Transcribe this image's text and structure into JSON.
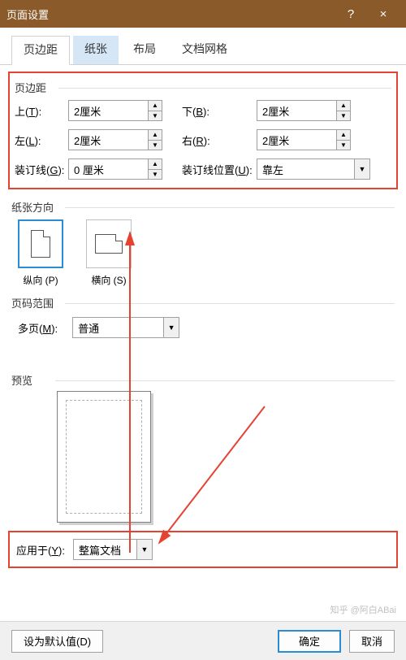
{
  "window": {
    "title": "页面设置",
    "help": "?",
    "close": "×"
  },
  "tabs": {
    "items": [
      "页边距",
      "纸张",
      "布局",
      "文档网格"
    ],
    "active": 0,
    "hover": 1
  },
  "margins": {
    "title": "页边距",
    "top_label": "上(T):",
    "top_value": "2厘米",
    "bottom_label": "下(B):",
    "bottom_value": "2厘米",
    "left_label": "左(L):",
    "left_value": "2厘米",
    "right_label": "右(R):",
    "right_value": "2厘米",
    "gutter_label": "装订线(G):",
    "gutter_value": "0 厘米",
    "gutter_pos_label": "装订线位置(U):",
    "gutter_pos_value": "靠左"
  },
  "orientation": {
    "title": "纸张方向",
    "portrait": "纵向 (P)",
    "landscape": "横向 (S)"
  },
  "pagerange": {
    "title": "页码范围",
    "multi_label": "多页(M):",
    "multi_value": "普通"
  },
  "preview": {
    "title": "预览"
  },
  "apply": {
    "label": "应用于(Y):",
    "value": "整篇文档"
  },
  "footer": {
    "defaults": "设为默认值(D)",
    "ok": "确定",
    "cancel": "取消"
  },
  "watermark": "知乎 @阿白ABai"
}
